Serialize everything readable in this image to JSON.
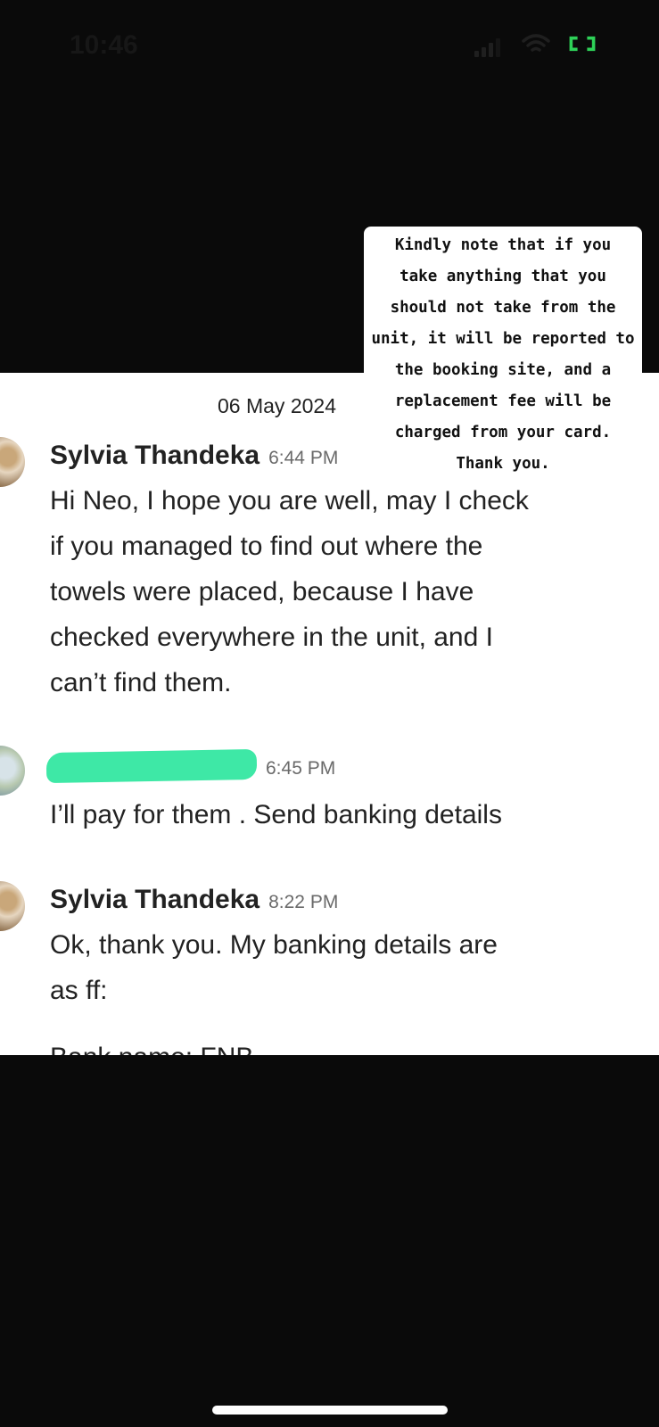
{
  "status_bar": {
    "time": "10:46"
  },
  "colors": {
    "battery": "#2ed158",
    "redaction": "#3ee8a6"
  },
  "note": {
    "lines": [
      "Kindly note that if you",
      "take anything that you",
      "should not take from the",
      "unit, it will be reported to",
      "the booking site, and a",
      "replacement fee will be",
      "charged from your card.",
      "Thank you."
    ]
  },
  "chat": {
    "date": "06 May 2024",
    "messages": [
      {
        "sender": "Sylvia Thandeka",
        "time": "6:44 PM",
        "text": "Hi Neo, I hope you are well, may I check\nif you managed to find out where the\ntowels were placed, because I have\nchecked everywhere in the unit, and I\ncan’t find them."
      },
      {
        "sender": "",
        "time": "6:45 PM",
        "text": "I’ll pay for them . Send banking details"
      },
      {
        "sender": "Sylvia Thandeka",
        "time": "8:22 PM",
        "text": "Ok, thank you. My banking details are\nas ff:"
      }
    ],
    "cut_off_text": "Bank name: FNB"
  }
}
